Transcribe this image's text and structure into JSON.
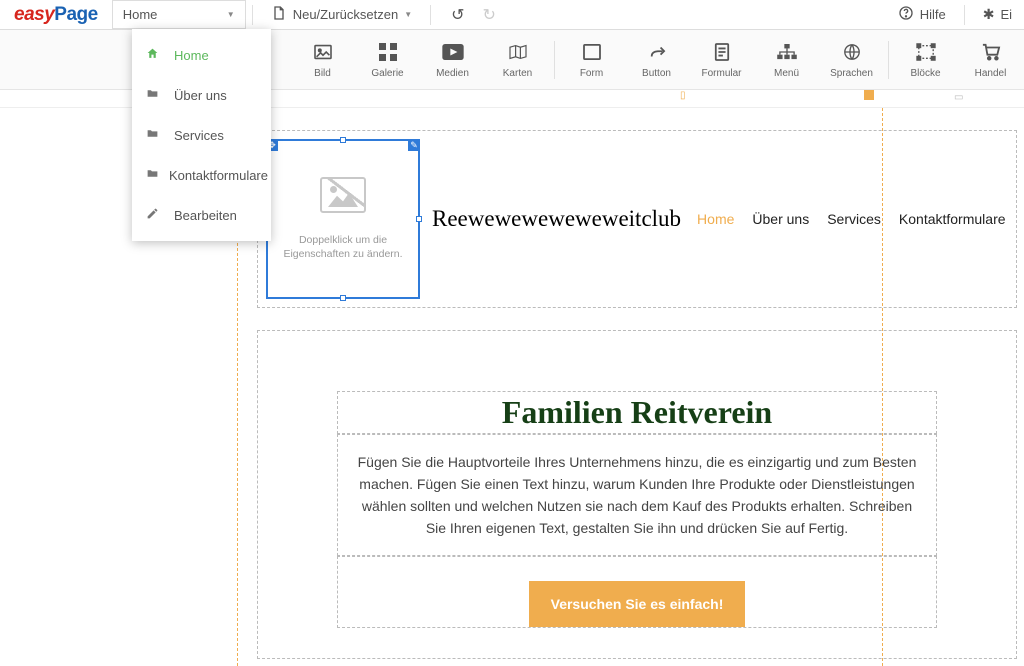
{
  "brand": {
    "part1": "easy",
    "part2": "Page"
  },
  "top": {
    "currentPage": "Home",
    "new_reset": "Neu/Zurücksetzen",
    "help": "Hilfe",
    "settings_prefix": "Ei"
  },
  "dropdown": {
    "items": [
      {
        "label": "Home",
        "icon": "home",
        "active": true
      },
      {
        "label": "Über uns",
        "icon": "folder",
        "active": false
      },
      {
        "label": "Services",
        "icon": "folder",
        "active": false
      },
      {
        "label": "Kontaktformulare",
        "icon": "folder",
        "active": false
      },
      {
        "label": "Bearbeiten",
        "icon": "pencil",
        "active": false
      }
    ]
  },
  "toolbar": [
    {
      "label": "Bild",
      "icon": "image"
    },
    {
      "label": "Galerie",
      "icon": "grid"
    },
    {
      "label": "Medien",
      "icon": "play"
    },
    {
      "label": "Karten",
      "icon": "map"
    },
    {
      "label": "Form",
      "icon": "form"
    },
    {
      "label": "Button",
      "icon": "share"
    },
    {
      "label": "Formular",
      "icon": "doc"
    },
    {
      "label": "Menü",
      "icon": "sitemap"
    },
    {
      "label": "Sprachen",
      "icon": "globe"
    },
    {
      "label": "Blöcke",
      "icon": "blocks"
    },
    {
      "label": "Handel",
      "icon": "cart"
    }
  ],
  "placeholder": {
    "line1": "Doppelklick um die",
    "line2": "Eigenschaften zu ändern."
  },
  "site": {
    "title": "Reeweweweweweweitclub",
    "nav": [
      "Home",
      "Über uns",
      "Services",
      "Kontaktformulare"
    ],
    "heading": "Familien Reitverein",
    "paragraph": "Fügen Sie die Hauptvorteile Ihres Unternehmens hinzu, die es einzigartig und zum Besten machen. Fügen Sie einen Text hinzu, warum Kunden Ihre Produkte oder Dienstleistungen wählen sollten und welchen Nutzen sie nach dem Kauf des Produkts erhalten. Schreiben Sie Ihren eigenen Text, gestalten Sie ihn und drücken Sie auf Fertig.",
    "cta": "Versuchen Sie es einfach!"
  }
}
